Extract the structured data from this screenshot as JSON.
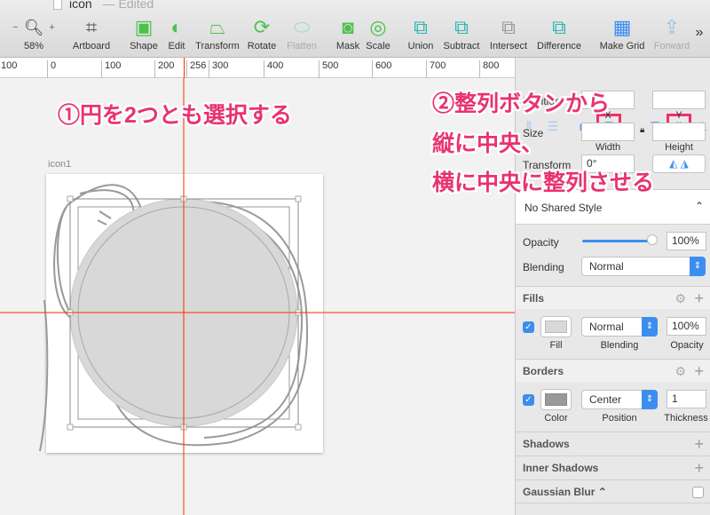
{
  "window": {
    "title": "icon",
    "status": "— Edited"
  },
  "toolbar": {
    "zoom": "58%",
    "zoom_minus": "−",
    "zoom_plus": "+",
    "items": [
      {
        "label": "Artboard",
        "icon": "artboard-icon"
      },
      {
        "label": "Shape",
        "icon": "shape-icon"
      },
      {
        "label": "Edit",
        "icon": "edit-icon"
      },
      {
        "label": "Transform",
        "icon": "transform-icon"
      },
      {
        "label": "Rotate",
        "icon": "rotate-icon"
      },
      {
        "label": "Flatten",
        "icon": "flatten-icon"
      },
      {
        "label": "Mask",
        "icon": "mask-icon"
      },
      {
        "label": "Scale",
        "icon": "scale-icon"
      },
      {
        "label": "Union",
        "icon": "union-icon"
      },
      {
        "label": "Subtract",
        "icon": "subtract-icon"
      },
      {
        "label": "Intersect",
        "icon": "intersect-icon"
      },
      {
        "label": "Difference",
        "icon": "difference-icon"
      },
      {
        "label": "Make Grid",
        "icon": "grid-icon"
      },
      {
        "label": "Forward",
        "icon": "forward-icon"
      }
    ],
    "more": "»"
  },
  "ruler": {
    "labels": [
      "100",
      "0",
      "100",
      "200",
      "256",
      "300",
      "400",
      "500",
      "600",
      "700",
      "800"
    ]
  },
  "canvas": {
    "artboard_name": "icon1"
  },
  "annotations": {
    "step1": "①円を2つとも選択する",
    "step2_line1": "②整列ボタンから",
    "step2_line2": "縦に中央、",
    "step2_line3": "横に中央に整列させる"
  },
  "inspector": {
    "position_label": "Position",
    "x_label": "X",
    "y_label": "Y",
    "size_label": "Size",
    "width_label": "Width",
    "height_label": "Height",
    "transform_label": "Transform",
    "rotation": "0°",
    "shared_style": "No Shared Style",
    "opacity_label": "Opacity",
    "opacity_value": "100%",
    "opacity_level": 100,
    "blending_label": "Blending",
    "blending_value": "Normal",
    "fills": {
      "title": "Fills",
      "blending": "Normal",
      "opacity": "100%",
      "fill_label": "Fill",
      "blending_label": "Blending",
      "opacity_label": "Opacity",
      "color": "#d8d8d8",
      "enabled": true
    },
    "borders": {
      "title": "Borders",
      "position": "Center",
      "thickness": "1",
      "color_label": "Color",
      "position_label": "Position",
      "thickness_label": "Thickness",
      "color": "#999999",
      "enabled": true
    },
    "shadows": "Shadows",
    "inner_shadows": "Inner Shadows",
    "gaussian_blur": "Gaussian Blur"
  },
  "colors": {
    "annotation": "#e8336e",
    "guide": "#ff2a00",
    "accent": "#3b8ef0"
  }
}
